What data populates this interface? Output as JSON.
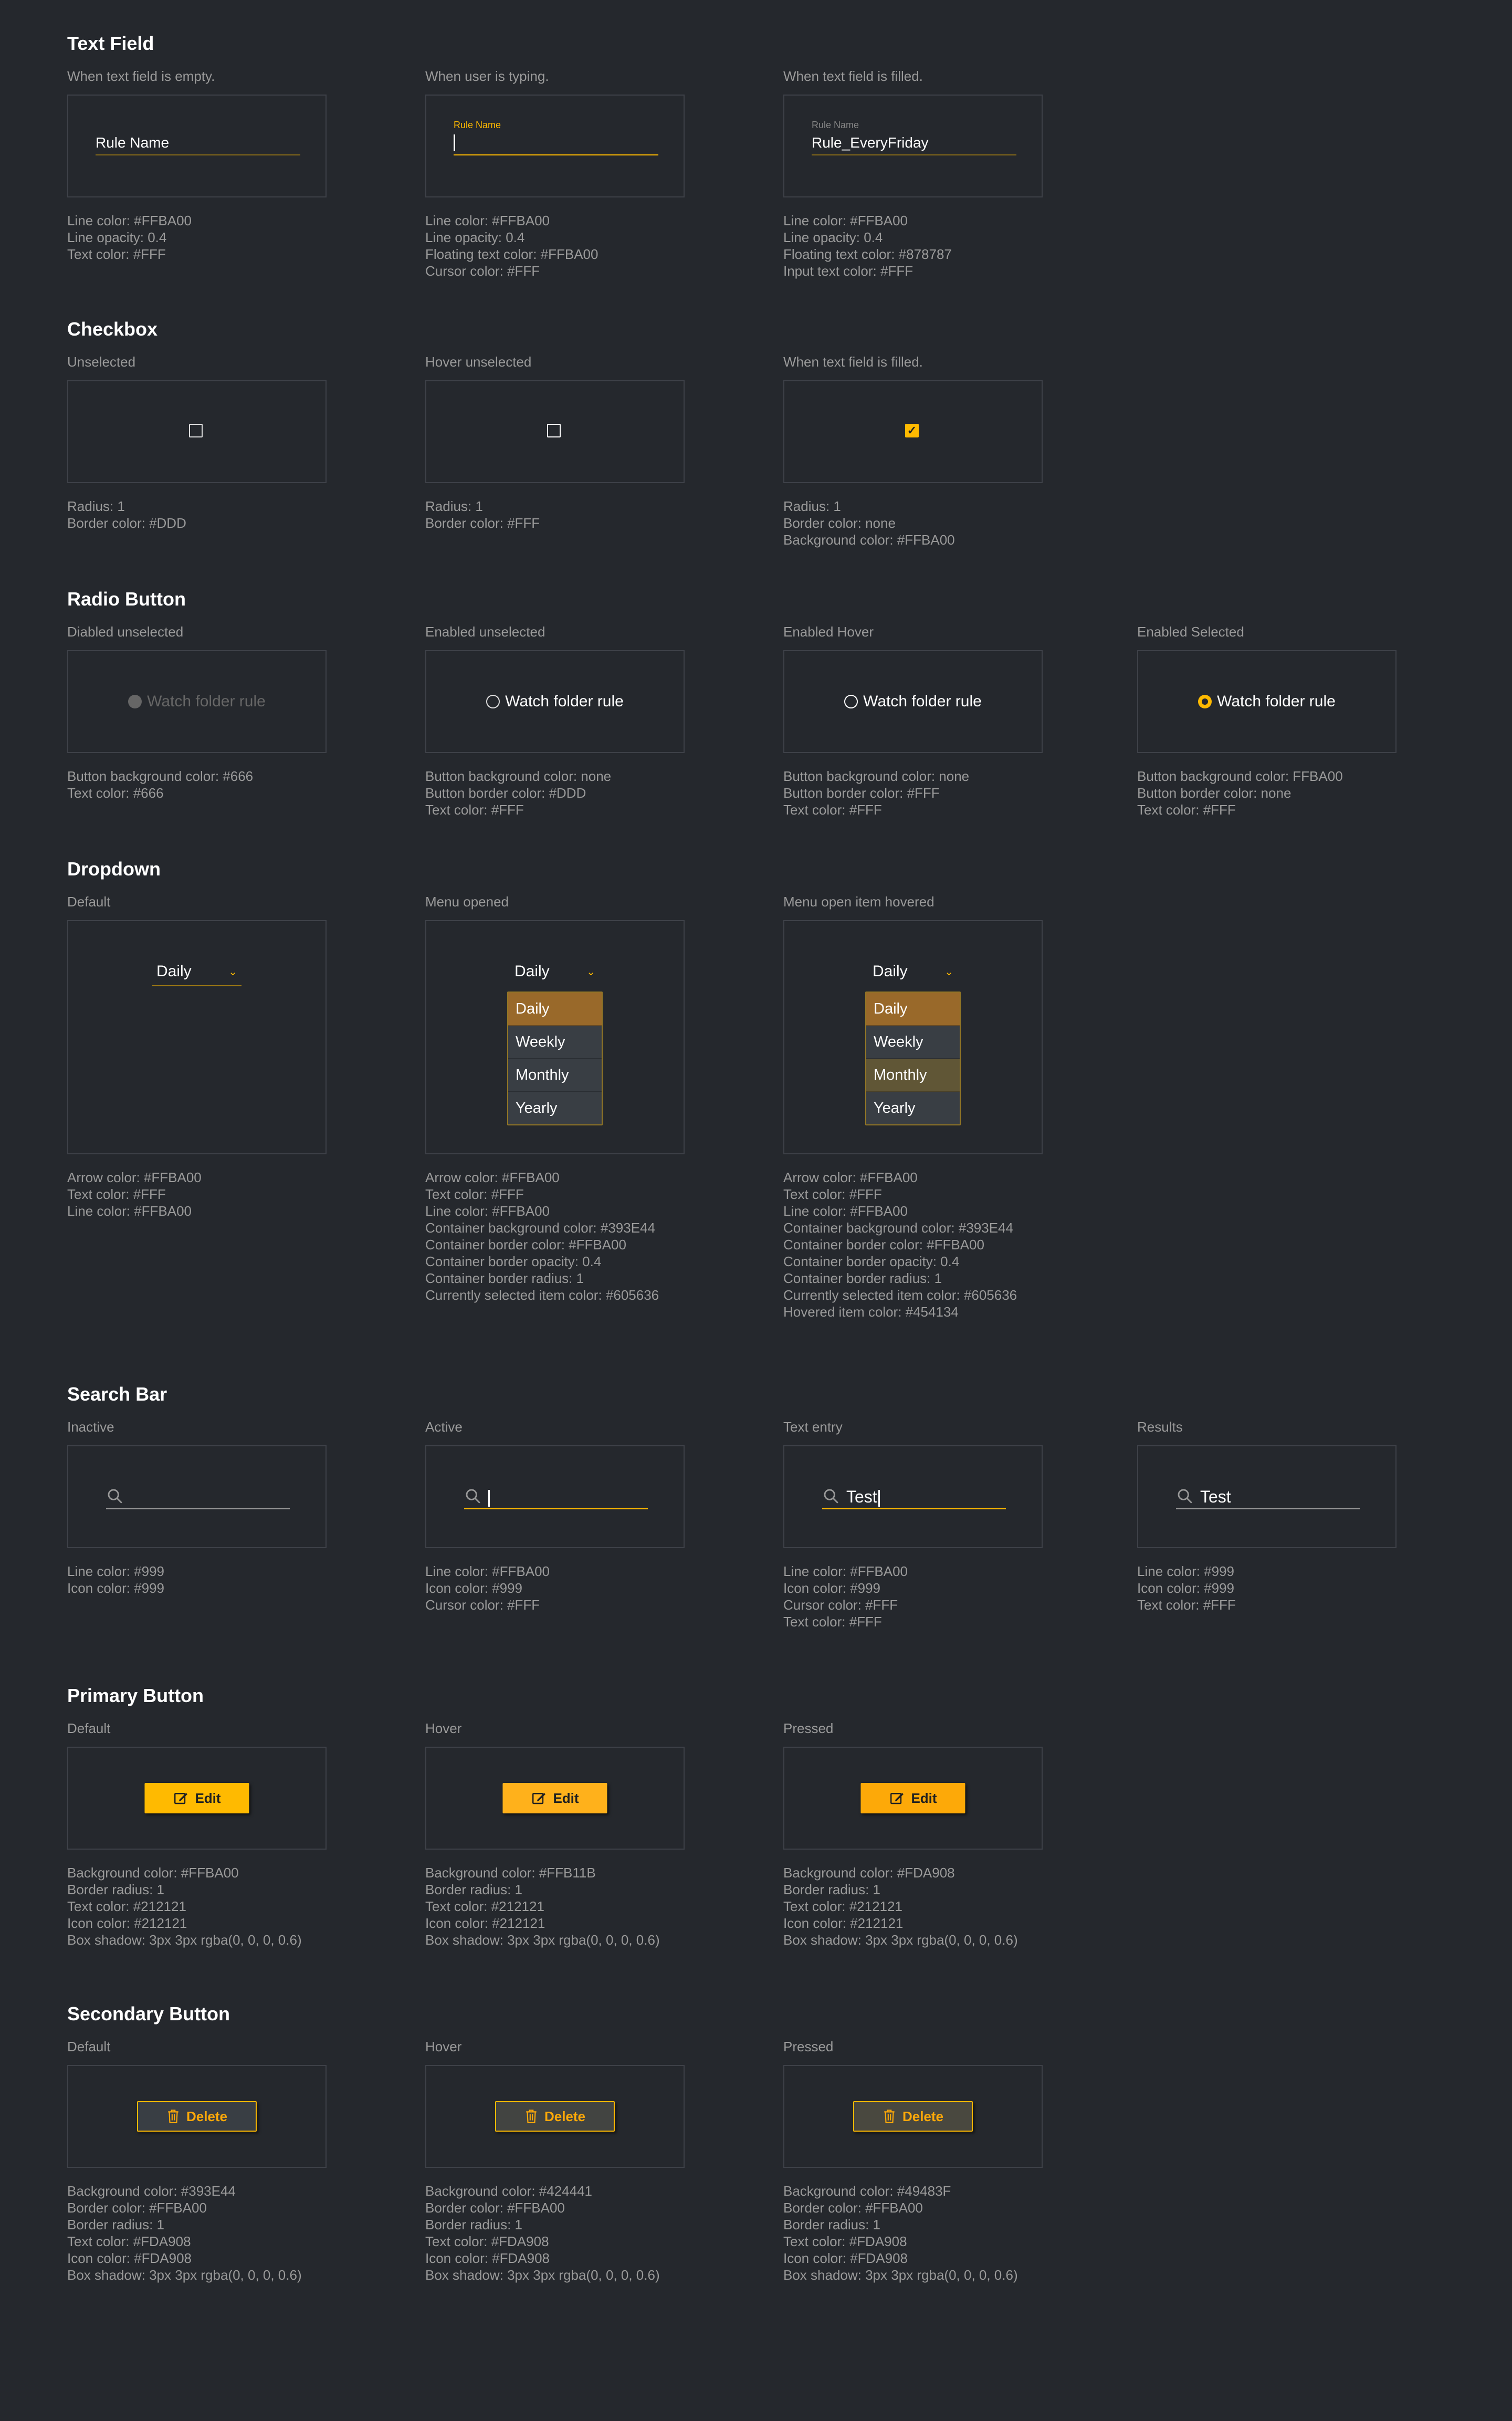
{
  "colors": {
    "background": "#25282D",
    "accent": "#FFBA00",
    "panel_border": "#3E4148",
    "note_text": "#9A9A9A",
    "container": "#393E44",
    "selected_item": "#605636",
    "hovered_item": "#454134",
    "primary_default": "#FFBA00",
    "primary_hover": "#FFB11B",
    "primary_pressed": "#FDA908",
    "secondary_default": "#393E44",
    "secondary_hover": "#424441",
    "secondary_pressed": "#49483F"
  },
  "text_field": {
    "title": "Text Field",
    "cells": [
      {
        "label": "When text field is empty.",
        "placeholder": "Rule Name",
        "notes": [
          "Line color: #FFBA00",
          "Line opacity: 0.4",
          "Text color: #FFF"
        ]
      },
      {
        "label": "When user is typing.",
        "floating": "Rule Name",
        "notes": [
          "Line color: #FFBA00",
          "Line opacity: 0.4",
          "Floating text color: #FFBA00",
          "Cursor color: #FFF"
        ]
      },
      {
        "label": "When text field is filled.",
        "floating": "Rule Name",
        "value": "Rule_EveryFriday",
        "notes": [
          "Line color: #FFBA00",
          "Line opacity: 0.4",
          "Floating text color: #878787",
          "Input text color: #FFF"
        ]
      }
    ]
  },
  "checkbox": {
    "title": "Checkbox",
    "cells": [
      {
        "label": "Unselected",
        "notes": [
          "Radius: 1",
          "Border color: #DDD"
        ]
      },
      {
        "label": "Hover unselected",
        "notes": [
          "Radius: 1",
          "Border color: #FFF"
        ]
      },
      {
        "label": "When text field is filled.",
        "notes": [
          "Radius: 1",
          "Border color: none",
          "Background color: #FFBA00"
        ]
      }
    ]
  },
  "radio": {
    "title": "Radio Button",
    "option_label": "Watch folder rule",
    "cells": [
      {
        "label": "Diabled unselected",
        "notes": [
          "Button background color: #666",
          "Text color: #666"
        ]
      },
      {
        "label": "Enabled unselected",
        "notes": [
          "Button background color: none",
          "Button border color: #DDD",
          "Text color: #FFF"
        ]
      },
      {
        "label": "Enabled Hover",
        "notes": [
          "Button background color: none",
          "Button border color: #FFF",
          "Text color: #FFF"
        ]
      },
      {
        "label": "Enabled Selected",
        "notes": [
          "Button background color: FFBA00",
          "Button border color: none",
          "Text color: #FFF"
        ]
      }
    ]
  },
  "dropdown": {
    "title": "Dropdown",
    "selected": "Daily",
    "options": [
      "Daily",
      "Weekly",
      "Monthly",
      "Yearly"
    ],
    "cells": [
      {
        "label": "Default",
        "notes": [
          "Arrow color: #FFBA00",
          "Text color: #FFF",
          "Line color: #FFBA00"
        ]
      },
      {
        "label": "Menu opened",
        "notes": [
          "Arrow color: #FFBA00",
          "Text color: #FFF",
          "Line color: #FFBA00",
          "Container background color: #393E44",
          "Container border color: #FFBA00",
          "Container border opacity: 0.4",
          "Container border radius: 1",
          "Currently selected item color: #605636"
        ]
      },
      {
        "label": "Menu open item hovered",
        "notes": [
          "Arrow color: #FFBA00",
          "Text color: #FFF",
          "Line color: #FFBA00",
          "Container background color: #393E44",
          "Container border color: #FFBA00",
          "Container border opacity: 0.4",
          "Container border radius: 1",
          "Currently selected item color: #605636",
          "Hovered item color: #454134"
        ]
      }
    ]
  },
  "search": {
    "title": "Search Bar",
    "cells": [
      {
        "label": "Inactive",
        "value": "",
        "notes": [
          "Line color: #999",
          "Icon color: #999"
        ]
      },
      {
        "label": "Active",
        "value": "",
        "notes": [
          "Line color: #FFBA00",
          "Icon color: #999",
          "Cursor color: #FFF"
        ]
      },
      {
        "label": "Text entry",
        "value": "Test",
        "notes": [
          "Line color: #FFBA00",
          "Icon color: #999",
          "Cursor color: #FFF",
          "Text color: #FFF"
        ]
      },
      {
        "label": "Results",
        "value": "Test",
        "notes": [
          "Line color: #999",
          "Icon color: #999",
          "Text color: #FFF"
        ]
      }
    ]
  },
  "primary_button": {
    "title": "Primary Button",
    "button_label": "Edit",
    "icon": "edit-icon",
    "cells": [
      {
        "label": "Default",
        "notes": [
          "Background color: #FFBA00",
          "Border radius: 1",
          "Text color: #212121",
          "Icon color: #212121",
          "Box shadow: 3px 3px rgba(0, 0, 0, 0.6)"
        ]
      },
      {
        "label": "Hover",
        "notes": [
          "Background color: #FFB11B",
          "Border radius: 1",
          "Text color: #212121",
          "Icon color: #212121",
          "Box shadow: 3px 3px rgba(0, 0, 0, 0.6)"
        ]
      },
      {
        "label": "Pressed",
        "notes": [
          "Background color: #FDA908",
          "Border radius: 1",
          "Text color: #212121",
          "Icon color: #212121",
          "Box shadow: 3px 3px rgba(0, 0, 0, 0.6)"
        ]
      }
    ]
  },
  "secondary_button": {
    "title": "Secondary Button",
    "button_label": "Delete",
    "icon": "trash-icon",
    "cells": [
      {
        "label": "Default",
        "notes": [
          "Background color: #393E44",
          "Border color: #FFBA00",
          "Border radius: 1",
          "Text color: #FDA908",
          "Icon color: #FDA908",
          "Box shadow: 3px 3px rgba(0, 0, 0, 0.6)"
        ]
      },
      {
        "label": "Hover",
        "notes": [
          "Background color: #424441",
          "Border color: #FFBA00",
          "Border radius: 1",
          "Text color: #FDA908",
          "Icon color: #FDA908",
          "Box shadow: 3px 3px rgba(0, 0, 0, 0.6)"
        ]
      },
      {
        "label": "Pressed",
        "notes": [
          "Background color: #49483F",
          "Border color: #FFBA00",
          "Border radius: 1",
          "Text color: #FDA908",
          "Icon color: #FDA908",
          "Box shadow: 3px 3px rgba(0, 0, 0, 0.6)"
        ]
      }
    ]
  }
}
